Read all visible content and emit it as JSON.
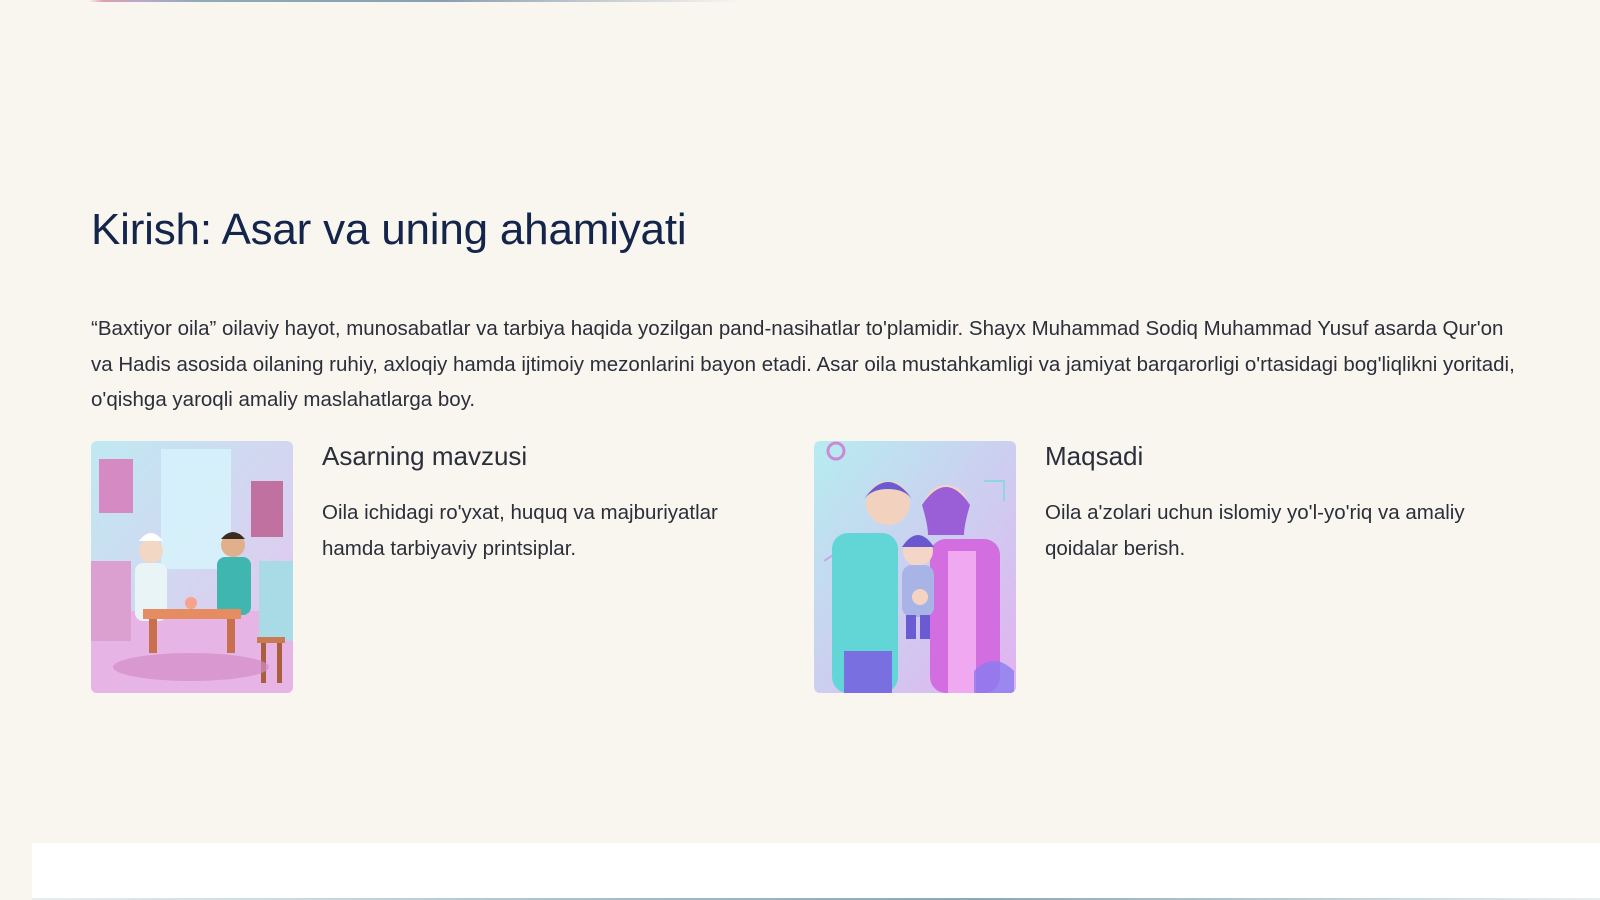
{
  "slide": {
    "title": "Kirish: Asar va uning ahamiyati",
    "intro": "“Baxtiyor oila” oilaviy hayot, munosabatlar va tarbiya haqida yozilgan pand-nasihatlar to'plamidir. Shayx Muhammad Sodiq Muhammad Yusuf asarda Qur'on va Hadis asosida oilaning ruhiy, axloqiy hamda ijtimoiy mezonlarini bayon etadi. Asar oila mustahkamligi va jamiyat barqarorligi o'rtasidagi bog'liqlikni yoritadi, o'qishga yaroqli amaliy maslahatlarga boy.",
    "cards": [
      {
        "title": "Asarning mavzusi",
        "text": "Oila ichidagi ro'yxat, huquq va majburiyatlar hamda tarbiyaviy printsiplar.",
        "image": "illustration-two-men-at-tea-table"
      },
      {
        "title": "Maqsadi",
        "text": "Oila a'zolari uchun islomiy yo'l-yo'riq va amaliy qoidalar berish.",
        "image": "illustration-parents-holding-child"
      }
    ]
  },
  "colors": {
    "background": "#f9f5ef",
    "title": "#13254a",
    "body_text": "#2b2f3a"
  }
}
